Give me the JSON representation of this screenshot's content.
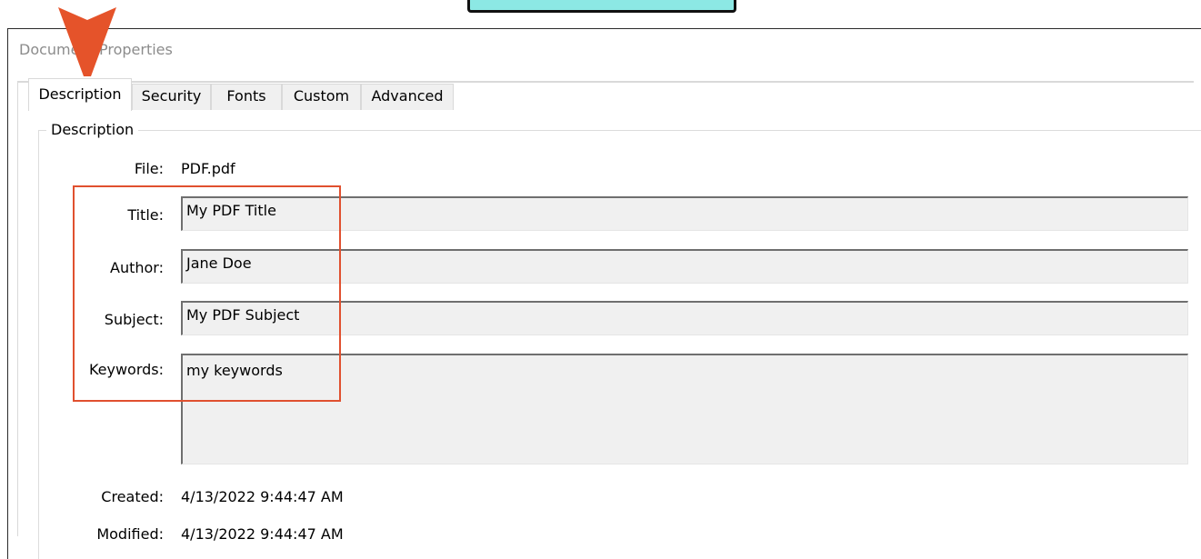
{
  "window": {
    "title": "Document Properties"
  },
  "tabs": [
    {
      "label": "Description",
      "active": true
    },
    {
      "label": "Security",
      "active": false
    },
    {
      "label": "Fonts",
      "active": false
    },
    {
      "label": "Custom",
      "active": false
    },
    {
      "label": "Advanced",
      "active": false
    }
  ],
  "group": {
    "label": "Description"
  },
  "fields": {
    "file": {
      "label": "File:",
      "value": "PDF.pdf"
    },
    "title": {
      "label": "Title:",
      "value": "My PDF Title"
    },
    "author": {
      "label": "Author:",
      "value": "Jane Doe"
    },
    "subject": {
      "label": "Subject:",
      "value": "My PDF Subject"
    },
    "keywords": {
      "label": "Keywords:",
      "value": "my keywords"
    },
    "created": {
      "label": "Created:",
      "value": "4/13/2022 9:44:47 AM"
    },
    "modified": {
      "label": "Modified:",
      "value": "4/13/2022 9:44:47 AM"
    }
  },
  "annotations": {
    "arrow_icon": "pointer-arrow-icon",
    "arrow_color": "#e5532a",
    "highlight_color": "#e0502f",
    "callout_color": "#8ce8e4"
  }
}
